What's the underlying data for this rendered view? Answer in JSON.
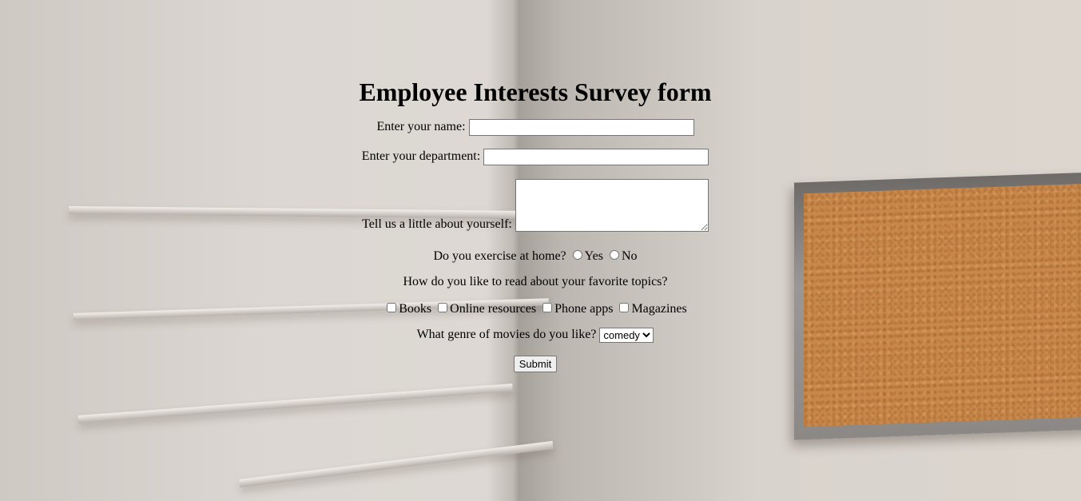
{
  "form": {
    "title": "Employee Interests Survey form",
    "name_label": "Enter your name:",
    "name_value": "",
    "department_label": "Enter your department:",
    "department_value": "",
    "about_label": "Tell us a little about yourself:",
    "about_value": "",
    "exercise_label": "Do you exercise at home?",
    "exercise_options": [
      "Yes",
      "No"
    ],
    "read_label": "How do you like to read about your favorite topics?",
    "read_options": [
      "Books",
      "Online resources",
      "Phone apps",
      "Magazines"
    ],
    "genre_label": "What genre of movies do you like?",
    "genre_selected": "comedy",
    "submit_label": "Submit"
  },
  "colors": {
    "wall": "#d8d2cc",
    "cork": "#c9874a",
    "frame": "#8b8885"
  }
}
